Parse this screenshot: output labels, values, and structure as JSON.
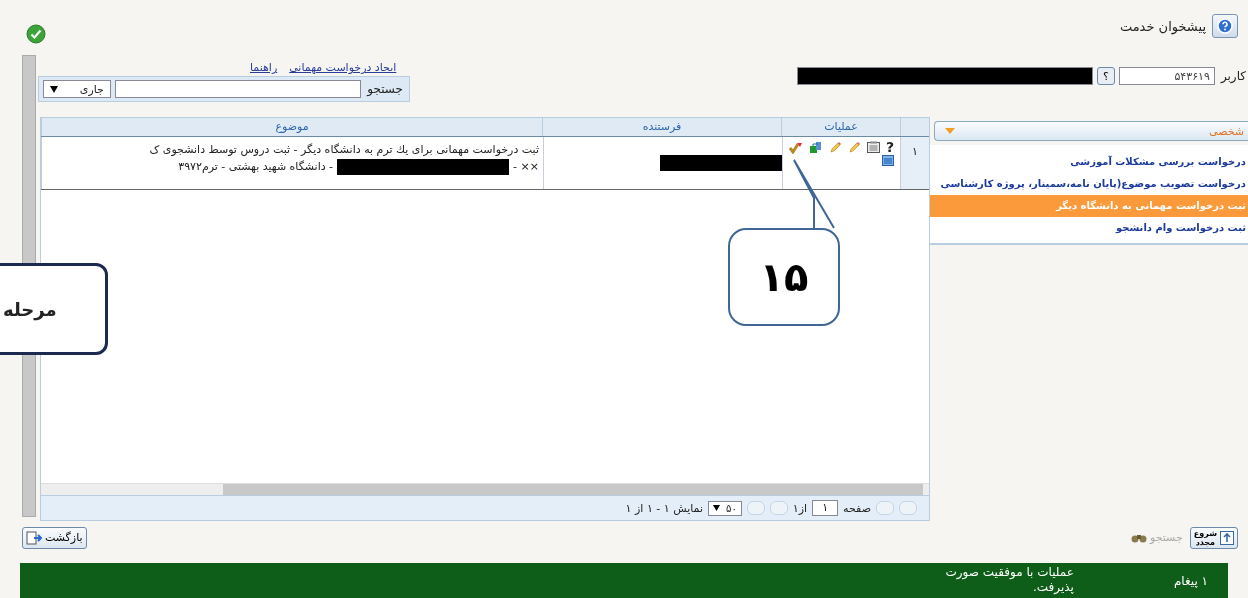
{
  "header": {
    "title": "پیشخوان خدمت"
  },
  "user": {
    "label": "کاربر",
    "code": "۵۴۳۶۱۹",
    "lookup": "؟"
  },
  "links": [
    "ایجاد درخواست مهمانی",
    "راهنما"
  ],
  "search": {
    "label": "جستجو",
    "filter": "جاری"
  },
  "table": {
    "columns": [
      "عملیات",
      "فرستنده",
      "موضوع"
    ],
    "rows": [
      {
        "index": "۱",
        "help": "?",
        "subject_line_1": "ثبت درخواست مهمانی برای یك ترم به دانشگاه دیگر - ثبت دروس توسط دانشجوی ک",
        "subject_line_2_start": "×× -",
        "subject_line_2_end": "- دانشگاه شهید بهشتی - ترم۳۹۷۲"
      }
    ]
  },
  "pager": {
    "page_label": "صفحه",
    "page": "۱",
    "of_pages": "از۱",
    "page_size": "۵۰",
    "summary": "نمایش ۱ - ۱ از ۱"
  },
  "sidebar": {
    "header": "شخصی",
    "items": [
      {
        "label": "درخواست بررسی مشکلات آموزشی",
        "selected": false
      },
      {
        "label": "درخواست تصویب موضوع(پایان نامه،سمینار، پروژه کارشناسی",
        "selected": false
      },
      {
        "label": "ثبت درخواست مهمانی به دانشگاه دیگر",
        "selected": true
      },
      {
        "label": "ثبت درخواست وام دانشجو",
        "selected": false
      }
    ]
  },
  "buttons": {
    "back": "بازگشت",
    "restart_top": "شروع",
    "restart_bottom": "مجدد",
    "search": {
      "label": "جستجو",
      "disabled": true
    }
  },
  "status_bar": {
    "count": "۱ پیغام",
    "message": "عملیات با موفقیت صورت پذیرفت."
  },
  "callouts": [
    {
      "kind": "pointer",
      "text": "۱۵"
    },
    {
      "kind": "box",
      "text": "مرحله"
    }
  ]
}
